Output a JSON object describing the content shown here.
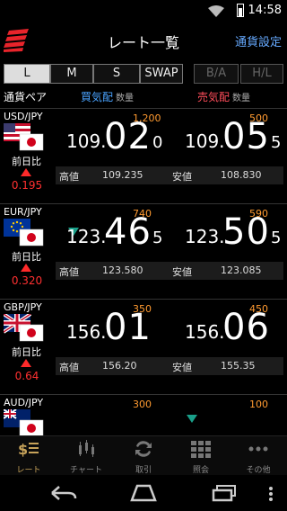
{
  "status": {
    "time": "14:58"
  },
  "header": {
    "title": "レート一覧",
    "settings": "通貨設定"
  },
  "tabs": [
    {
      "label": "L",
      "active": true
    },
    {
      "label": "M"
    },
    {
      "label": "S"
    },
    {
      "label": "SWAP"
    },
    {
      "label": "B/A",
      "disabled": true
    },
    {
      "label": "H/L",
      "disabled": true
    }
  ],
  "columns": {
    "pair": "通貨ペア",
    "bid": "買気配",
    "ask": "売気配",
    "qty": "数量"
  },
  "rows": [
    {
      "pair": "USD/JPY",
      "bid_qty": "1,200",
      "ask_qty": "500",
      "bid": {
        "lead": "109.",
        "big": "02",
        "tail": "0"
      },
      "ask": {
        "lead": "109.",
        "big": "05",
        "tail": "5"
      },
      "prev_label": "前日比",
      "change": "0.195",
      "high_label": "高値",
      "high": "109.235",
      "low_label": "安値",
      "low": "108.830"
    },
    {
      "pair": "EUR/JPY",
      "bid_qty": "740",
      "ask_qty": "590",
      "bid": {
        "lead": "123.",
        "big": "46",
        "tail": "5"
      },
      "ask": {
        "lead": "123.",
        "big": "50",
        "tail": "5"
      },
      "prev_label": "前日比",
      "change": "0.320",
      "high_label": "高値",
      "high": "123.580",
      "low_label": "安値",
      "low": "123.085"
    },
    {
      "pair": "GBP/JPY",
      "bid_qty": "350",
      "ask_qty": "450",
      "bid": {
        "lead": "156.",
        "big": "01",
        "tail": ""
      },
      "ask": {
        "lead": "156.",
        "big": "06",
        "tail": ""
      },
      "prev_label": "前日比",
      "change": "0.64",
      "high_label": "高値",
      "high": "156.20",
      "low_label": "安値",
      "low": "155.35"
    },
    {
      "pair": "AUD/JPY",
      "bid_qty": "300",
      "ask_qty": "100"
    }
  ],
  "nav": [
    {
      "label": "レート",
      "icon": "rate-icon",
      "active": true
    },
    {
      "label": "チャート",
      "icon": "chart-icon"
    },
    {
      "label": "取引",
      "icon": "trade-icon"
    },
    {
      "label": "照会",
      "icon": "inquiry-grid-icon"
    },
    {
      "label": "その他",
      "icon": "more-icon"
    }
  ],
  "colors": {
    "bid": "#4aa3ff",
    "ask": "#ff4d5a",
    "qty": "#ff9a30",
    "change": "#ff3030",
    "logo": "#e8242b"
  }
}
